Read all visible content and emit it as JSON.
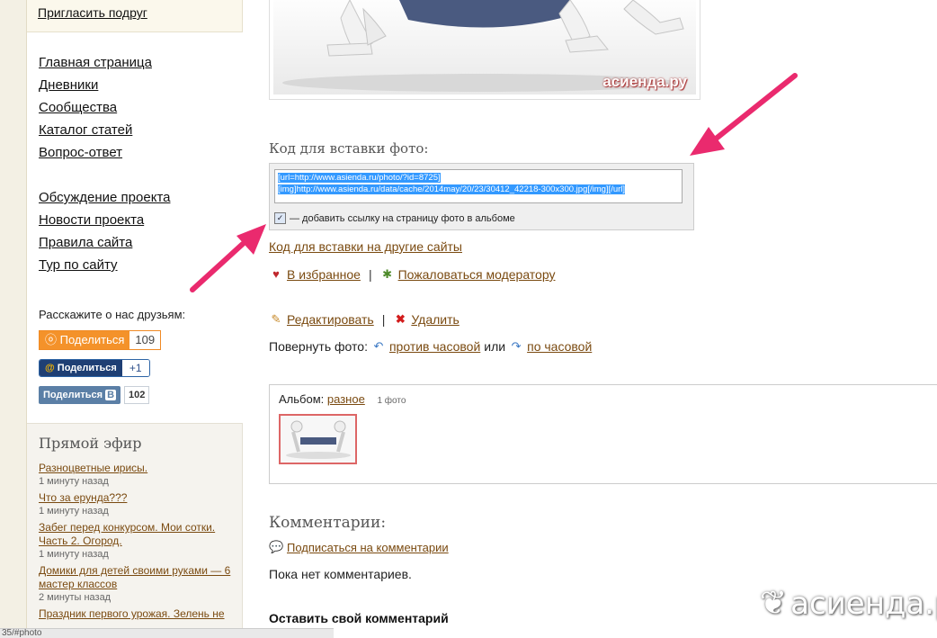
{
  "sidebar": {
    "invite_link": "Пригласить подруг",
    "nav_primary": [
      "Главная страница",
      "Дневники",
      "Сообщества",
      "Каталог статей",
      "Вопрос-ответ"
    ],
    "nav_secondary": [
      "Обсуждение проекта",
      "Новости проекта",
      "Правила сайта",
      "Тур по сайту"
    ],
    "share": {
      "label": "Расскажите о нас друзьям:",
      "ok": {
        "label": "Поделиться",
        "count": "109"
      },
      "mail": {
        "label": "Поделиться",
        "count": "+1"
      },
      "vk": {
        "label": "Поделиться",
        "count": "102"
      }
    },
    "live": {
      "title": "Прямой эфир",
      "items": [
        {
          "title": "Разноцветные ирисы.",
          "time": "1 минуту назад"
        },
        {
          "title": "Что за ерунда???",
          "time": "1 минуту назад"
        },
        {
          "title": "Забег перед конкурсом. Мои сотки. Часть 2. Огород.",
          "time": "1 минуту назад"
        },
        {
          "title": "Домики для детей своими руками — 6 мастер классов",
          "time": "2 минуты назад"
        },
        {
          "title": "Праздник первого урожая. Зелень не",
          "time": ""
        }
      ]
    },
    "statusbar": "35/#photo"
  },
  "main": {
    "photo_watermark": "асиенда.ру",
    "embed": {
      "title": "Код для вставки фото:",
      "line1": "[url=http://www.asienda.ru/photo/?id=8725]",
      "line2": "[img]http://www.asienda.ru/data/cache/2014may/20/23/30412_42218-300x300.jpg[/img][/url]",
      "checkbox_label": "— добавить ссылку на страницу фото в альбоме",
      "checkbox_checked": true
    },
    "other_sites_link": "Код для вставки на другие сайты",
    "favorite_link": "В избранное",
    "complain_link": "Пожаловаться модератору",
    "edit_link": "Редактировать",
    "delete_link": "Удалить",
    "rotate": {
      "label": "Повернуть фото:",
      "ccw": "против часовой",
      "or": "или",
      "cw": "по часовой"
    },
    "album": {
      "label": "Альбом:",
      "name": "разное",
      "count": "1 фото"
    },
    "comments": {
      "title": "Комментарии:",
      "subscribe": "Подписаться на комментарии",
      "empty": "Пока нет комментариев.",
      "leave": "Оставить свой комментарий"
    }
  },
  "watermark": "асиенда.ру",
  "colors": {
    "link": "#7a4a10",
    "arrow": "#ea2a6e",
    "ok": "#f4922a",
    "vk": "#5b7fa6"
  }
}
